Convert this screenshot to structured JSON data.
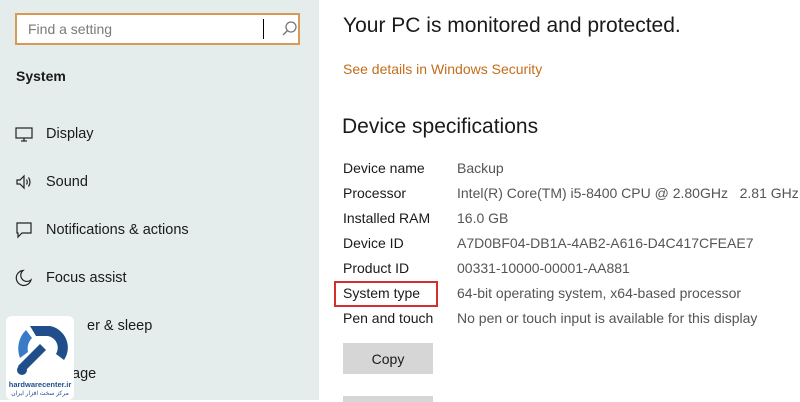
{
  "sidebar": {
    "search_placeholder": "Find a setting",
    "section_title": "System",
    "items": [
      {
        "label": "Display",
        "icon": "display-icon"
      },
      {
        "label": "Sound",
        "icon": "speaker-icon"
      },
      {
        "label": "Notifications & actions",
        "icon": "notification-icon"
      },
      {
        "label": "Focus assist",
        "icon": "moon-icon"
      },
      {
        "label": "er & sleep",
        "icon": "power-icon"
      },
      {
        "label": "age",
        "icon": "storage-icon"
      }
    ]
  },
  "main": {
    "security_heading": "Your PC is monitored and protected.",
    "security_link": "See details in Windows Security",
    "specs_heading": "Device specifications",
    "specs": [
      {
        "label": "Device name",
        "value": "Backup"
      },
      {
        "label": "Processor",
        "value": "Intel(R) Core(TM) i5-8400 CPU @ 2.80GHz   2.81 GHz"
      },
      {
        "label": "Installed RAM",
        "value": "16.0 GB"
      },
      {
        "label": "Device ID",
        "value": "A7D0BF04-DB1A-4AB2-A616-D4C417CFEAE7"
      },
      {
        "label": "Product ID",
        "value": "00331-10000-00001-AA881"
      },
      {
        "label": "System type",
        "value": "64-bit operating system, x64-based processor"
      },
      {
        "label": "Pen and touch",
        "value": "No pen or touch input is available for this display"
      }
    ],
    "copy_label": "Copy"
  },
  "watermark": {
    "site": "hardwarecenter.ir",
    "tagline": "مرکز سخت افزار ایران"
  },
  "colors": {
    "sidebar_bg": "#e5ecec",
    "accent": "#c46d1a",
    "highlight": "#d32f2f"
  }
}
